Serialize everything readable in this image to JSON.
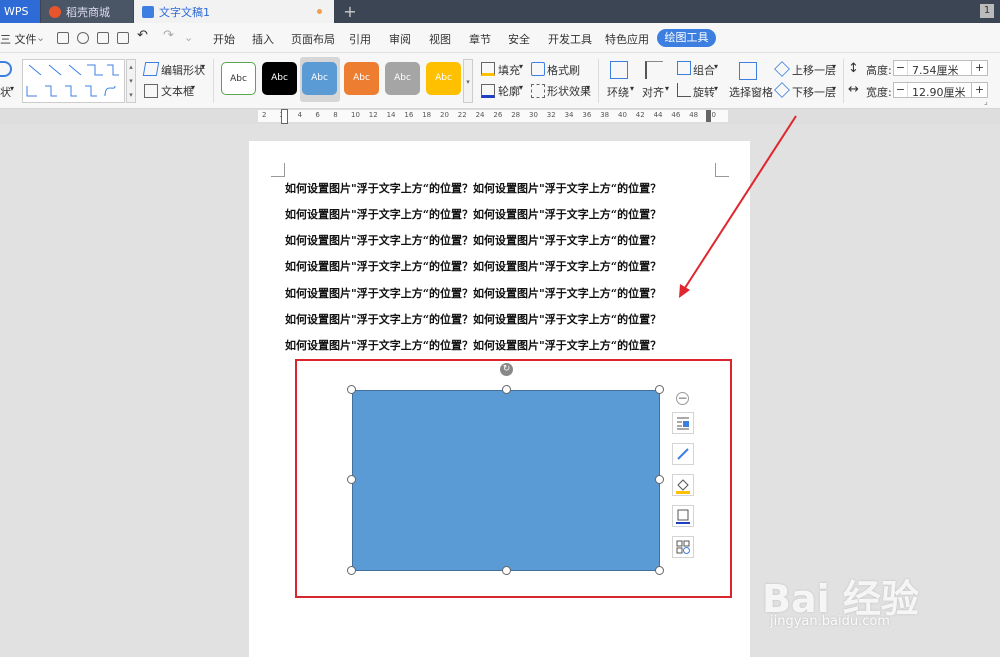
{
  "titlebar": {
    "wps_label": "WPS",
    "store_tab": "稻壳商城",
    "doc_tab": "文字文稿1",
    "new_tab": "+",
    "window_count": "1"
  },
  "menubar": {
    "file": "三 文件",
    "items": [
      "开始",
      "插入",
      "页面布局",
      "引用",
      "审阅",
      "视图",
      "章节",
      "安全",
      "开发工具",
      "特色应用"
    ],
    "active": "绘图工具"
  },
  "ribbon": {
    "shape_label": "状",
    "edit_shape": "编辑形状",
    "text_box": "文本框",
    "style_samples": [
      "Abc",
      "Abc",
      "Abc",
      "Abc",
      "Abc",
      "Abc"
    ],
    "style_colors": [
      "#ffffff",
      "#000000",
      "#5b9bd5",
      "#ed7d31",
      "#a5a5a5",
      "#ffc000"
    ],
    "fill": "填充",
    "format_painter": "格式刷",
    "outline": "轮廓",
    "shape_effect": "形状效果",
    "wrap": "环绕",
    "align": "对齐",
    "group": "组合",
    "rotate": "旋转",
    "selection_pane": "选择窗格",
    "bring_forward": "上移一层",
    "send_backward": "下移一层",
    "height_label": "高度:",
    "height_value": "7.54厘米",
    "width_label": "宽度:",
    "width_value": "12.90厘米"
  },
  "ruler": {
    "ticks": [
      "2",
      "2",
      "4",
      "6",
      "8",
      "10",
      "12",
      "14",
      "16",
      "18",
      "20",
      "22",
      "24",
      "26",
      "28",
      "30",
      "32",
      "34",
      "36",
      "38",
      "40",
      "42",
      "44",
      "46",
      "48",
      "50"
    ]
  },
  "document": {
    "lines": [
      "如何设置图片\"浮于文字上方“的位置？如何设置图片\"浮于文字上方“的位置？",
      "如何设置图片\"浮于文字上方“的位置？如何设置图片\"浮于文字上方“的位置？",
      "如何设置图片\"浮于文字上方“的位置？如何设置图片\"浮于文字上方“的位置？",
      "如何设置图片\"浮于文字上方“的位置？如何设置图片\"浮于文字上方“的位置？",
      "如何设置图片\"浮于文字上方“的位置？如何设置图片\"浮于文字上方“的位置？",
      "如何设置图片\"浮于文字上方“的位置？如何设置图片\"浮于文字上方“的位置？",
      "如何设置图片\"浮于文字上方“的位置？如何设置图片\"浮于文字上方“的位置？"
    ],
    "shape_color": "#5b9bd5",
    "annotation_color": "#d9262e"
  },
  "watermark": {
    "brand": "Bai 经验",
    "url": "jingyan.baidu.com"
  }
}
